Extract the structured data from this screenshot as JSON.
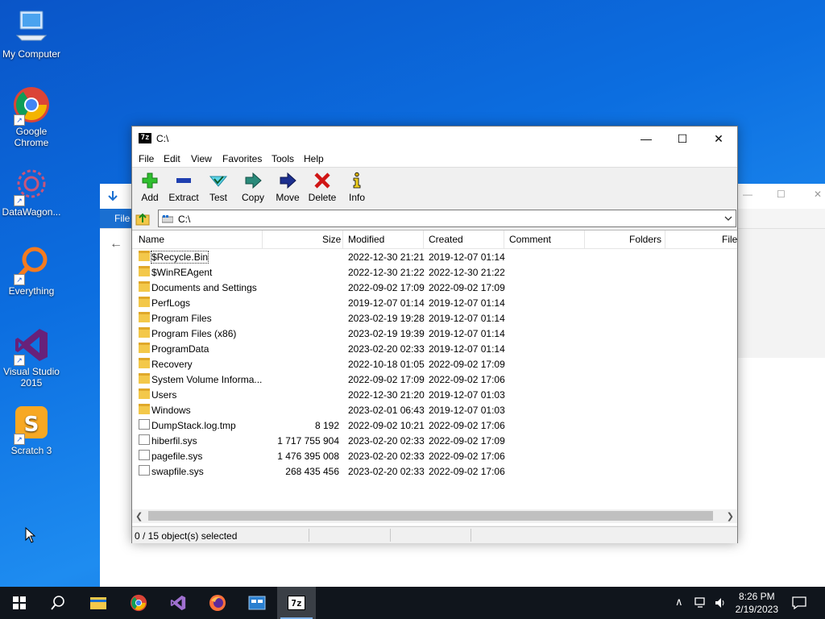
{
  "desktop": {
    "icons": [
      {
        "label": "My Computer"
      },
      {
        "label": "Google Chrome"
      },
      {
        "label": "DataWagon..."
      },
      {
        "label": "Everything"
      },
      {
        "label": "Visual Studio 2015"
      },
      {
        "label": "Scratch 3"
      }
    ]
  },
  "background_window": {
    "file_tab": "File"
  },
  "window": {
    "title": "C:\\",
    "app_icon_text": "7z",
    "controls": {
      "minimize": "—",
      "maximize": "☐",
      "close": "✕"
    }
  },
  "menu": {
    "items": [
      "File",
      "Edit",
      "View",
      "Favorites",
      "Tools",
      "Help"
    ]
  },
  "toolbar": {
    "buttons": [
      {
        "label": "Add",
        "icon": "add-icon",
        "color": "#2fbf2f"
      },
      {
        "label": "Extract",
        "icon": "extract-icon",
        "color": "#1f3fb0"
      },
      {
        "label": "Test",
        "icon": "test-icon",
        "color": "#22b3c8"
      },
      {
        "label": "Copy",
        "icon": "copy-icon",
        "color": "#2a8a7a"
      },
      {
        "label": "Move",
        "icon": "move-icon",
        "color": "#1c2f8f"
      },
      {
        "label": "Delete",
        "icon": "delete-icon",
        "color": "#d01515"
      },
      {
        "label": "Info",
        "icon": "info-icon",
        "color": "#d8b000"
      }
    ]
  },
  "address": {
    "path": "C:\\"
  },
  "columns": [
    "Name",
    "Size",
    "Modified",
    "Created",
    "Comment",
    "Folders",
    "File"
  ],
  "files": [
    {
      "name": "$Recycle.Bin",
      "size": "",
      "modified": "2022-12-30 21:21",
      "created": "2019-12-07 01:14",
      "type": "folder"
    },
    {
      "name": "$WinREAgent",
      "size": "",
      "modified": "2022-12-30 21:22",
      "created": "2022-12-30 21:22",
      "type": "folder"
    },
    {
      "name": "Documents and Settings",
      "size": "",
      "modified": "2022-09-02 17:09",
      "created": "2022-09-02 17:09",
      "type": "folder"
    },
    {
      "name": "PerfLogs",
      "size": "",
      "modified": "2019-12-07 01:14",
      "created": "2019-12-07 01:14",
      "type": "folder"
    },
    {
      "name": "Program Files",
      "size": "",
      "modified": "2023-02-19 19:28",
      "created": "2019-12-07 01:14",
      "type": "folder"
    },
    {
      "name": "Program Files (x86)",
      "size": "",
      "modified": "2023-02-19 19:39",
      "created": "2019-12-07 01:14",
      "type": "folder"
    },
    {
      "name": "ProgramData",
      "size": "",
      "modified": "2023-02-20 02:33",
      "created": "2019-12-07 01:14",
      "type": "folder"
    },
    {
      "name": "Recovery",
      "size": "",
      "modified": "2022-10-18 01:05",
      "created": "2022-09-02 17:09",
      "type": "folder"
    },
    {
      "name": "System Volume Informa...",
      "size": "",
      "modified": "2022-09-02 17:09",
      "created": "2022-09-02 17:06",
      "type": "folder"
    },
    {
      "name": "Users",
      "size": "",
      "modified": "2022-12-30 21:20",
      "created": "2019-12-07 01:03",
      "type": "folder"
    },
    {
      "name": "Windows",
      "size": "",
      "modified": "2023-02-01 06:43",
      "created": "2019-12-07 01:03",
      "type": "folder"
    },
    {
      "name": "DumpStack.log.tmp",
      "size": "8 192",
      "modified": "2022-09-02 10:21",
      "created": "2022-09-02 17:06",
      "type": "file"
    },
    {
      "name": "hiberfil.sys",
      "size": "1 717 755 904",
      "modified": "2023-02-20 02:33",
      "created": "2022-09-02 17:09",
      "type": "file"
    },
    {
      "name": "pagefile.sys",
      "size": "1 476 395 008",
      "modified": "2023-02-20 02:33",
      "created": "2022-09-02 17:06",
      "type": "file"
    },
    {
      "name": "swapfile.sys",
      "size": "268 435 456",
      "modified": "2023-02-20 02:33",
      "created": "2022-09-02 17:06",
      "type": "file"
    }
  ],
  "status": {
    "selected": "0 / 15 object(s) selected"
  },
  "taskbar": {
    "items": [
      {
        "icon": "windows-start-icon"
      },
      {
        "icon": "search-icon"
      },
      {
        "icon": "file-explorer-icon"
      },
      {
        "icon": "chrome-icon"
      },
      {
        "icon": "visual-studio-icon"
      },
      {
        "icon": "firefox-icon"
      },
      {
        "icon": "app-window-icon"
      },
      {
        "icon": "7zip-icon",
        "text": "7z"
      }
    ],
    "time": "8:26 PM",
    "date": "2/19/2023",
    "tray": {
      "chevron": "∧"
    }
  }
}
